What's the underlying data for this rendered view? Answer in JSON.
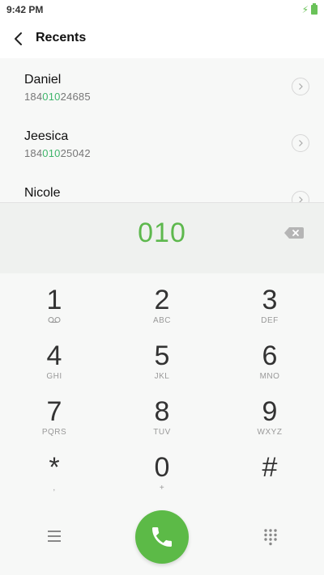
{
  "status_bar": {
    "time": "9:42 PM"
  },
  "header": {
    "title": "Recents"
  },
  "recents": [
    {
      "name": "Daniel",
      "number_prefix": "184",
      "number_match": "010",
      "number_suffix": "24685"
    },
    {
      "name": "Jeesica",
      "number_prefix": "184",
      "number_match": "010",
      "number_suffix": "25042"
    },
    {
      "name": "Nicole",
      "number_prefix": "",
      "number_match": "",
      "number_suffix": ""
    }
  ],
  "dial_display": {
    "dialed": "010"
  },
  "keypad": [
    {
      "digit": "1",
      "sub": "voicemail-icon"
    },
    {
      "digit": "2",
      "sub": "ABC"
    },
    {
      "digit": "3",
      "sub": "DEF"
    },
    {
      "digit": "4",
      "sub": "GHI"
    },
    {
      "digit": "5",
      "sub": "JKL"
    },
    {
      "digit": "6",
      "sub": "MNO"
    },
    {
      "digit": "7",
      "sub": "PQRS"
    },
    {
      "digit": "8",
      "sub": "TUV"
    },
    {
      "digit": "9",
      "sub": "WXYZ"
    },
    {
      "digit": "*",
      "sub": ","
    },
    {
      "digit": "0",
      "sub": "+"
    },
    {
      "digit": "#",
      "sub": ""
    }
  ],
  "colors": {
    "accent": "#5db84d",
    "call": "#5cba47",
    "match": "#3fb56b"
  }
}
